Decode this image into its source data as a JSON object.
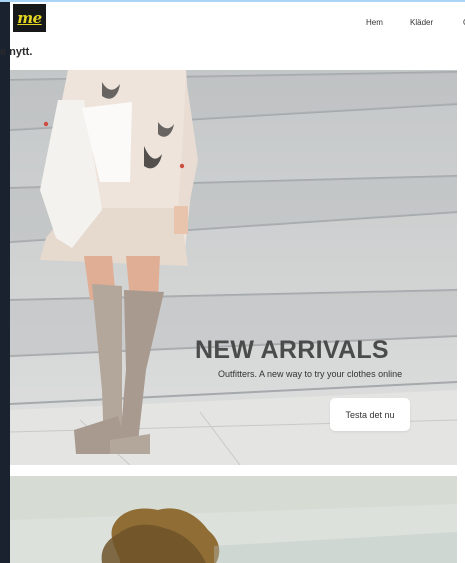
{
  "navbar": {
    "logo_text": "me",
    "links": [
      "Hem",
      "Kläder",
      "O"
    ]
  },
  "tagline": "e nytt.",
  "hero": {
    "title": "NEW ARRIVALS",
    "subtitle": "Outfitters. A new way to try your clothes online",
    "cta_label": "Testa det nu"
  },
  "colors": {
    "logo_bg": "#17181a",
    "logo_text": "#e4d623",
    "left_strip": "#1a2230",
    "top_line": "#a9d4f6"
  }
}
